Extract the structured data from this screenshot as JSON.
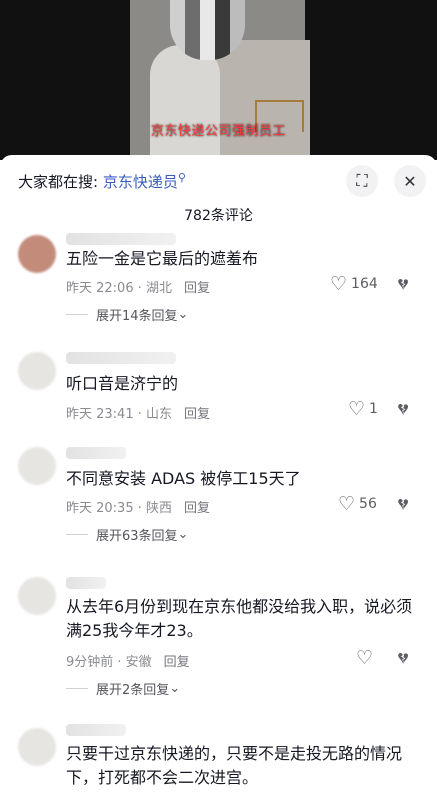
{
  "video": {
    "subtitle": "京东快递公司强制员工"
  },
  "header": {
    "search_prefix": "大家都在搜:",
    "search_keyword": "京东快递员",
    "search_icon": "search-icon",
    "expand_icon": "fullscreen-icon",
    "close_icon": "close-icon",
    "comment_count": "782条评论"
  },
  "comments": [
    {
      "text": "五险一金是它最后的遮羞布",
      "time": "昨天 22:06 · 湖北",
      "reply": "回复",
      "likes": "164",
      "expand": "展开14条回复"
    },
    {
      "text": "听口音是济宁的",
      "time": "昨天 23:41 · 山东",
      "reply": "回复",
      "likes": "1",
      "expand": ""
    },
    {
      "text": "不同意安装 ADAS 被停工15天了",
      "time": "昨天 20:35 · 陕西",
      "reply": "回复",
      "likes": "56",
      "expand": "展开63条回复"
    },
    {
      "text": "从去年6月份到现在京东他都没给我入职，说必须满25我今年才23。",
      "time": "9分钟前 · 安徽",
      "reply": "回复",
      "likes": "",
      "expand": "展开2条回复"
    },
    {
      "text": "只要干过京东快递的，只要不是走投无路的情况下，打死都不会二次进宫。",
      "time": "",
      "reply": "",
      "likes": "",
      "expand": ""
    }
  ],
  "icons": {
    "like": "heart-icon",
    "dislike": "broken-heart-icon",
    "chevron": "chevron-down-icon"
  }
}
